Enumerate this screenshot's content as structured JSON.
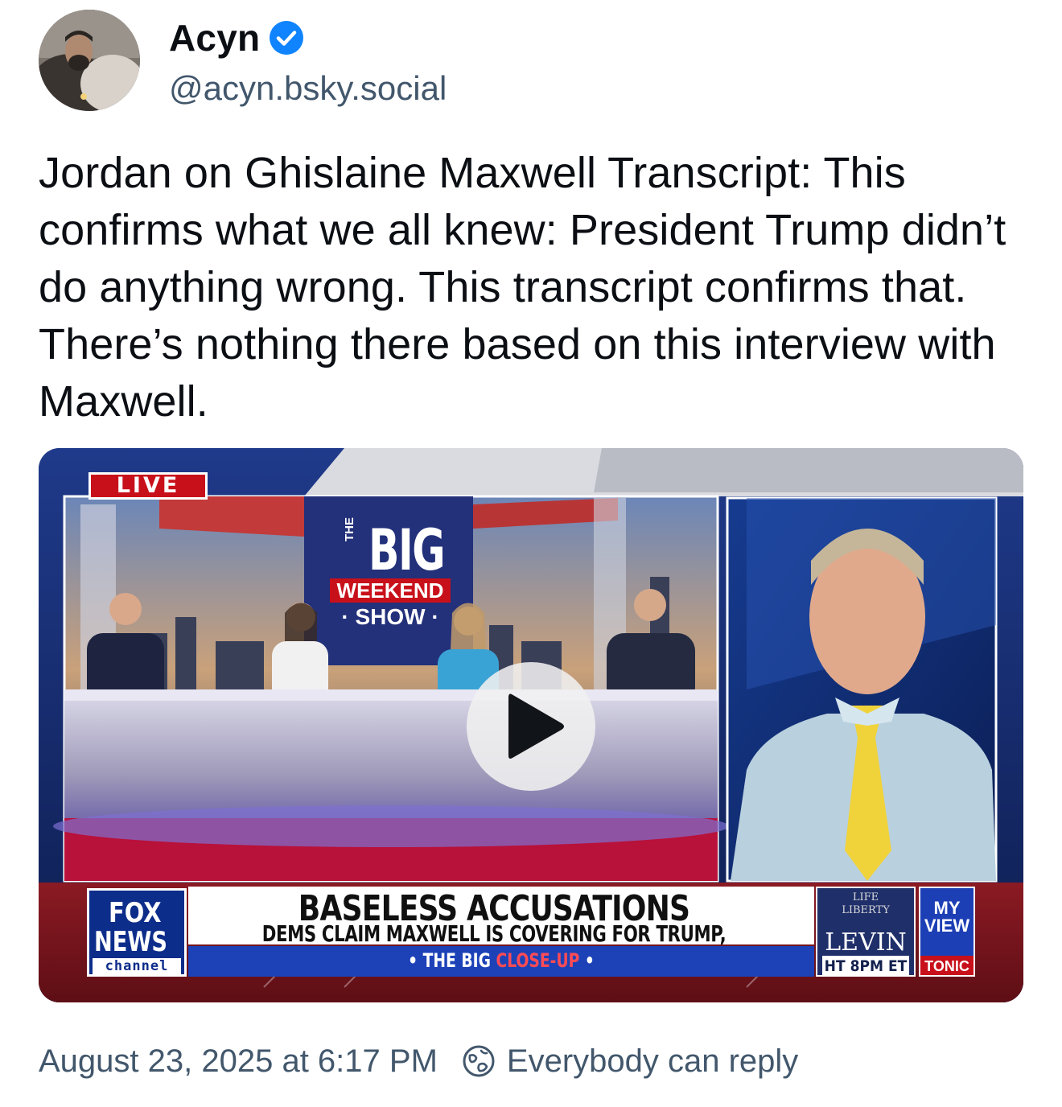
{
  "author": {
    "display_name": "Acyn",
    "handle": "@acyn.bsky.social",
    "verified_icon": "verified-check-icon",
    "verified_color": "#1083fe"
  },
  "post": {
    "text": "Jordan on Ghislaine Maxwell Transcript: This confirms what we all knew: President Trump didn’t do anything wrong. This transcript confirms that. There’s nothing there based on this interview with Maxwell."
  },
  "video": {
    "live_label": "LIVE",
    "show_logo": {
      "the": "THE",
      "big": "BIG",
      "weekend": "WEEKEND",
      "show": "· SHOW ·"
    },
    "network": {
      "line1": "FOX",
      "line2": "NEWS",
      "line3": "channel"
    },
    "headline": "BASELESS ACCUSATIONS",
    "subheadline": "DEMS CLAIM MAXWELL IS COVERING FOR TRUMP, WANTS PARDON",
    "segment_tag_prefix": "• THE BIG ",
    "segment_tag_red": "CLOSE-UP",
    "segment_tag_suffix": " •",
    "promo_a": {
      "line1": "LIFE",
      "line2": "LIBERTY",
      "line3": "LEVIN",
      "time": "HT 8PM ET"
    },
    "promo_b": {
      "line1": "MY",
      "line2": "VIEW",
      "bottom": "TONIC"
    },
    "play_icon": "play-icon"
  },
  "footer": {
    "timestamp": "August 23, 2025 at 6:17 PM",
    "reply_icon": "earth-globe-icon",
    "reply_setting": "Everybody can reply"
  },
  "colors": {
    "text_primary": "#0b0f14",
    "text_secondary": "#42576c",
    "fox_red": "#c8101a",
    "fox_blue": "#1d42b8"
  }
}
